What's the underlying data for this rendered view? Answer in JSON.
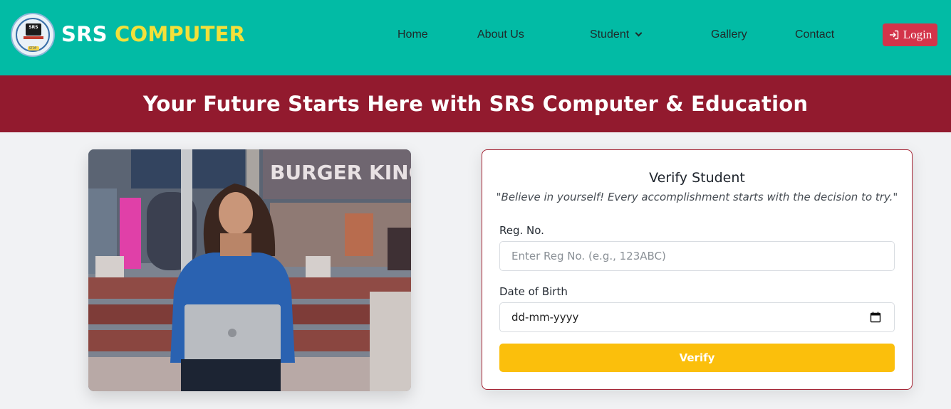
{
  "brand": {
    "part1": "SRS",
    "part2": "COMPUTER",
    "logo_text": "SRS",
    "logo_caption": "STOP"
  },
  "nav": {
    "items": [
      {
        "label": "Home"
      },
      {
        "label": "About Us"
      },
      {
        "label": "Student",
        "has_dropdown": true
      },
      {
        "label": "Gallery"
      },
      {
        "label": "Contact"
      }
    ],
    "login_label": "Login",
    "login_icon": "login-arrow-icon"
  },
  "banner": {
    "title": "Your Future Starts Here with SRS Computer & Education"
  },
  "photo": {
    "sign_text": "BURGER KING"
  },
  "verify_card": {
    "title": "Verify Student",
    "quote": "\"Believe in yourself! Every accomplishment starts with the decision to try.\"",
    "reg_label": "Reg. No.",
    "reg_placeholder": "Enter Reg No. (e.g., 123ABC)",
    "dob_label": "Date of Birth",
    "dob_placeholder": "dd-mm-yyyy",
    "button_label": "Verify"
  },
  "colors": {
    "header_bg": "#02bba5",
    "banner_bg": "#921a2e",
    "accent_yellow": "#fbbf0c",
    "login_bg": "#d3344a"
  }
}
